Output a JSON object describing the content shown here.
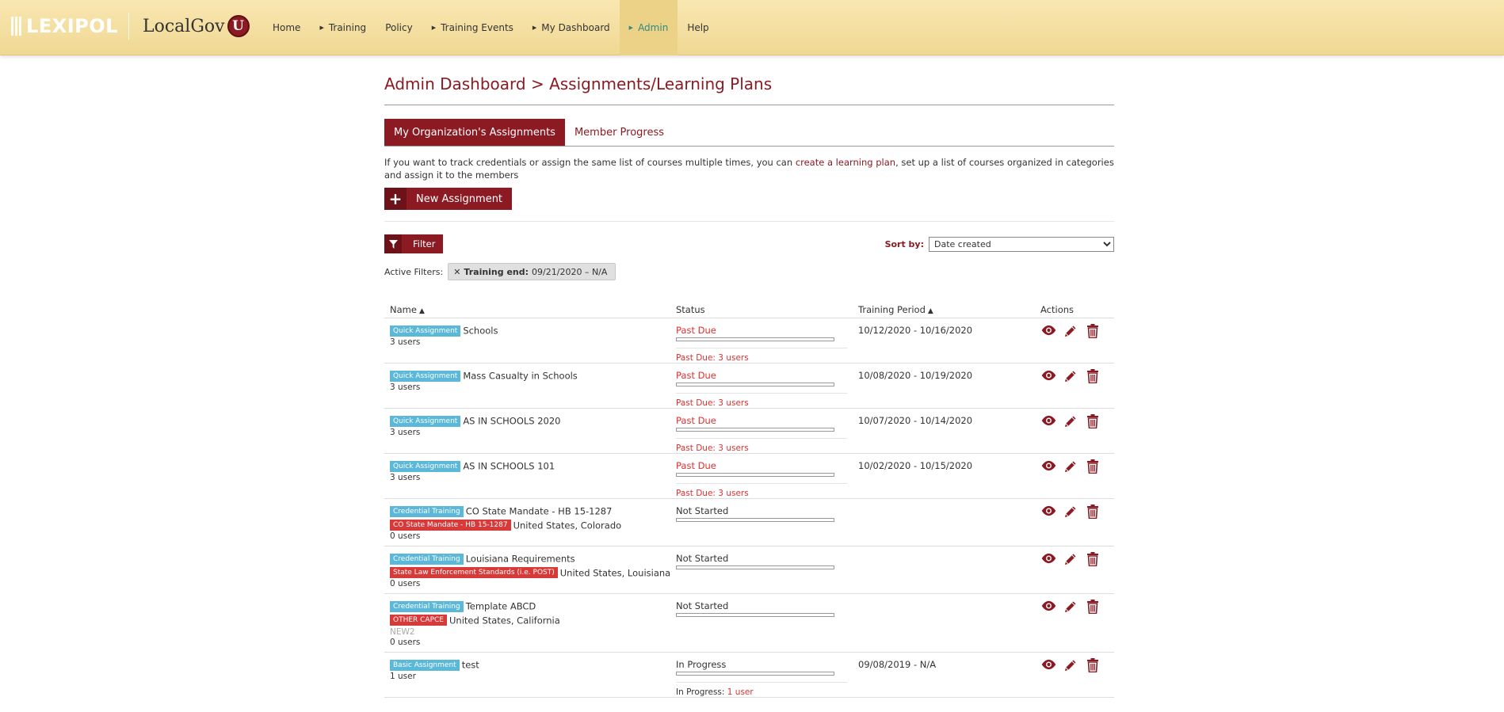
{
  "header": {
    "brand_main": "LEXIPOL",
    "brand_secondary": "LocalGov",
    "brand_badge": "U",
    "nav": [
      {
        "label": "Home",
        "arrow": false,
        "active": false
      },
      {
        "label": "Training",
        "arrow": true,
        "active": false
      },
      {
        "label": "Policy",
        "arrow": false,
        "active": false
      },
      {
        "label": "Training Events",
        "arrow": true,
        "active": false
      },
      {
        "label": "My Dashboard",
        "arrow": true,
        "active": false
      },
      {
        "label": "Admin",
        "arrow": true,
        "active": true
      },
      {
        "label": "Help",
        "arrow": false,
        "active": false
      }
    ]
  },
  "page": {
    "title": "Admin Dashboard > Assignments/Learning Plans",
    "tabs": {
      "active": "My Organization's Assignments",
      "inactive": "Member Progress"
    },
    "info": {
      "before": "If you want to track credentials or assign the same list of courses multiple times, you can ",
      "link": "create a learning plan",
      "after": ", set up a list of courses organized in categories and assign it to the members"
    },
    "new_assignment": "New Assignment",
    "filter_label": "Filter",
    "sort_by_label": "Sort by:",
    "sort_selected": "Date created",
    "active_filters_label": "Active Filters:",
    "chip": {
      "key": "Training end:",
      "value": "09/21/2020 – N/A"
    }
  },
  "table": {
    "headers": {
      "name": "Name",
      "status": "Status",
      "period": "Training Period",
      "actions": "Actions"
    },
    "rows": [
      {
        "badge": "Quick Assignment",
        "name": "Schools",
        "tag": "",
        "location": "",
        "extra": "",
        "users": "3 users",
        "status": "Past Due",
        "status_color": "red",
        "sub_prefix": "Past Due: 3 users",
        "sub_link": "",
        "period": "10/12/2020 - 10/16/2020"
      },
      {
        "badge": "Quick Assignment",
        "name": "Mass Casualty in Schools",
        "tag": "",
        "location": "",
        "extra": "",
        "users": "3 users",
        "status": "Past Due",
        "status_color": "red",
        "sub_prefix": "Past Due: 3 users",
        "sub_link": "",
        "period": "10/08/2020 - 10/19/2020"
      },
      {
        "badge": "Quick Assignment",
        "name": "AS IN SCHOOLS 2020",
        "tag": "",
        "location": "",
        "extra": "",
        "users": "3 users",
        "status": "Past Due",
        "status_color": "red",
        "sub_prefix": "Past Due: 3 users",
        "sub_link": "",
        "period": "10/07/2020 - 10/14/2020"
      },
      {
        "badge": "Quick Assignment",
        "name": "AS IN SCHOOLS 101",
        "tag": "",
        "location": "",
        "extra": "",
        "users": "3 users",
        "status": "Past Due",
        "status_color": "red",
        "sub_prefix": "Past Due: 3 users",
        "sub_link": "",
        "period": "10/02/2020 - 10/15/2020"
      },
      {
        "badge": "Credential Training",
        "name": "CO State Mandate - HB 15-1287",
        "tag": "CO State Mandate - HB 15-1287",
        "location": "United States, Colorado",
        "extra": "",
        "users": "0 users",
        "status": "Not Started",
        "status_color": "dark",
        "sub_prefix": "",
        "sub_link": "",
        "period": ""
      },
      {
        "badge": "Credential Training",
        "name": "Louisiana Requirements",
        "tag": "State Law Enforcement Standards (i.e. POST)",
        "location": "United States, Louisiana",
        "extra": "",
        "users": "0 users",
        "status": "Not Started",
        "status_color": "dark",
        "sub_prefix": "",
        "sub_link": "",
        "period": ""
      },
      {
        "badge": "Credential Training",
        "name": "Template ABCD",
        "tag": "OTHER CAPCE",
        "location": "United States, California",
        "extra": "NEW2",
        "users": "0 users",
        "status": "Not Started",
        "status_color": "dark",
        "sub_prefix": "",
        "sub_link": "",
        "period": ""
      },
      {
        "badge": "Basic Assignment",
        "name": "test",
        "tag": "",
        "location": "",
        "extra": "",
        "users": "1 user",
        "status": "In Progress",
        "status_color": "dark",
        "sub_prefix": "In Progress: ",
        "sub_link": "1 user",
        "period": "09/08/2019 - N/A"
      }
    ]
  },
  "icons": {
    "view": "eye-icon",
    "edit": "pencil-icon",
    "delete": "trash-icon",
    "filter": "funnel-icon",
    "add": "plus-icon",
    "remove": "close-icon"
  },
  "colors": {
    "brand": "#8b1a23",
    "badge_blue": "#5bb8d9",
    "badge_red": "#d83a3a",
    "past_due": "#e03030",
    "nav_active": "#2f8b86"
  }
}
